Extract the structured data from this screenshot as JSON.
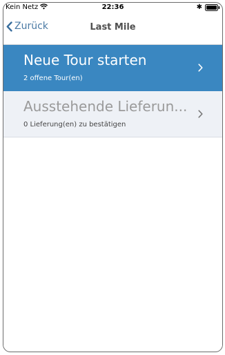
{
  "status_bar": {
    "carrier": "Kein Netz",
    "time": "22:36",
    "bluetooth_symbol": "✱"
  },
  "nav_bar": {
    "back_label": "Zurück",
    "title": "Last Mile"
  },
  "menu": {
    "items": [
      {
        "title": "Neue Tour starten",
        "subtitle": "2 offene Tour(en)",
        "chevron": "›"
      },
      {
        "title": "Ausstehende Lieferun...",
        "subtitle": "0 Lieferung(en) zu bestätigen",
        "chevron": "›"
      }
    ]
  },
  "colors": {
    "active_background": "#3a87c1",
    "inactive_background": "#eef1f6",
    "back_tint": "#4a7aa4"
  },
  "icons": [
    "wifi-icon",
    "bluetooth-icon",
    "battery-icon",
    "back-chevron-icon",
    "chevron-right-icon"
  ]
}
